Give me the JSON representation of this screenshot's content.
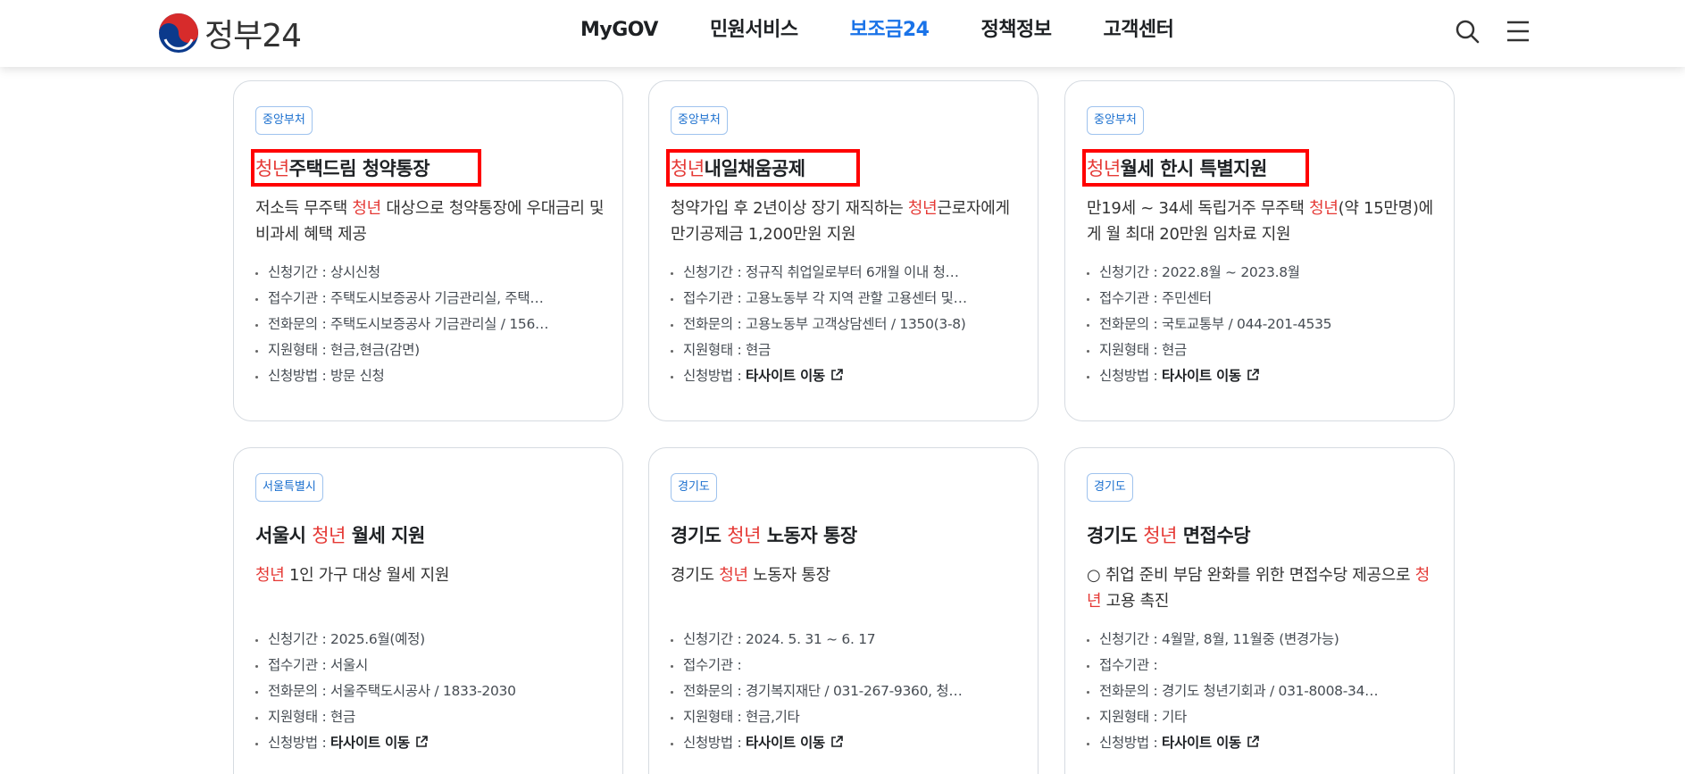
{
  "header": {
    "logo_text": "정부24",
    "nav": [
      "MyGOV",
      "민원서비스",
      "보조금24",
      "정책정보",
      "고객센터"
    ],
    "active_nav": "보조금24"
  },
  "info_labels": {
    "period": "신청기간 : ",
    "agency": "접수기관 : ",
    "phone": "전화문의 : ",
    "type": "지원형태 : ",
    "method": "신청방법 : "
  },
  "cards": [
    {
      "tag": "중앙부처",
      "title_hl": "청년",
      "title_rest": "주택드림 청약통장",
      "desc_parts": [
        "저소득 무주택 ",
        "청년",
        " 대상으로 청약통장에 우대금리 및 비과세 혜택 제공"
      ],
      "period": "상시신청",
      "agency": "주택도시보증공사 기금관리실, 주택…",
      "phone": "주택도시보증공사 기금관리실 / 156…",
      "type": "현금,현금(감면)",
      "method": "방문 신청",
      "method_external": false
    },
    {
      "tag": "중앙부처",
      "title_hl": "청년",
      "title_rest": "내일채움공제",
      "desc_parts": [
        "청약가입 후 2년이상 장기 재직하는 ",
        "청년",
        "근로자에게 만기공제금 1,200만원 지원"
      ],
      "period": "정규직 취업일로부터 6개월 이내 청…",
      "agency": "고용노동부 각 지역 관할 고용센터 및…",
      "phone": "고용노동부 고객상담센터 / 1350(3-8)",
      "type": "현금",
      "method": "타사이트 이동",
      "method_external": true
    },
    {
      "tag": "중앙부처",
      "title_hl": "청년",
      "title_rest": "월세 한시 특별지원",
      "desc_parts": [
        "만19세 ~ 34세 독립거주 무주택 ",
        "청년",
        "(약 15만명)에게 월 최대 20만원 임차료 지원"
      ],
      "period": "2022.8월 ~ 2023.8월",
      "agency": "주민센터",
      "phone": "국토교통부 / 044-201-4535",
      "type": "현금",
      "method": "타사이트 이동",
      "method_external": true
    },
    {
      "tag": "서울특별시",
      "title_pre": "서울시 ",
      "title_hl": "청년",
      "title_rest": " 월세 지원",
      "desc_parts": [
        "",
        "청년",
        " 1인 가구 대상 월세 지원"
      ],
      "period": "2025.6월(예정)",
      "agency": "서울시",
      "phone": "서울주택도시공사 / 1833-2030",
      "type": "현금",
      "method": "타사이트 이동",
      "method_external": true
    },
    {
      "tag": "경기도",
      "title_pre": "경기도 ",
      "title_hl": "청년",
      "title_rest": " 노동자 통장",
      "desc_parts": [
        "경기도 ",
        "청년",
        " 노동자 통장"
      ],
      "period": "2024. 5. 31 ~ 6. 17",
      "agency": "",
      "phone": "경기복지재단 / 031-267-9360, 청…",
      "type": "현금,기타",
      "method": "타사이트 이동",
      "method_external": true
    },
    {
      "tag": "경기도",
      "title_pre": "경기도 ",
      "title_hl": "청년",
      "title_rest": " 면접수당",
      "desc_parts": [
        "○ 취업 준비 부담 완화를 위한 면접수당 제공으로 ",
        "청년",
        " 고용 촉진"
      ],
      "period": "4월말, 8월, 11월중 (변경가능)",
      "agency": "",
      "phone": "경기도 청년기회과 / 031-8008-34…",
      "type": "기타",
      "method": "타사이트 이동",
      "method_external": true
    }
  ]
}
